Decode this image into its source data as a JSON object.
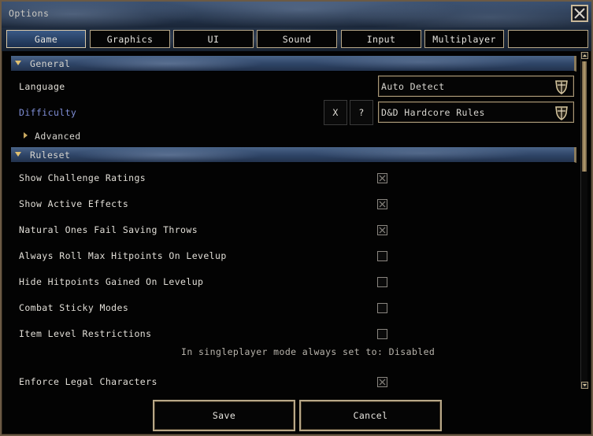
{
  "window": {
    "title": "Options"
  },
  "tabs": [
    {
      "label": "Game",
      "active": true
    },
    {
      "label": "Graphics",
      "active": false
    },
    {
      "label": "UI",
      "active": false
    },
    {
      "label": "Sound",
      "active": false
    },
    {
      "label": "Input",
      "active": false
    },
    {
      "label": "Multiplayer",
      "active": false
    },
    {
      "label": "",
      "active": false
    }
  ],
  "general": {
    "header": "General",
    "language_label": "Language",
    "language_value": "Auto Detect",
    "difficulty_label": "Difficulty",
    "difficulty_value": "D&D Hardcore Rules",
    "reset_button": "X",
    "help_button": "?",
    "advanced_label": "Advanced"
  },
  "ruleset": {
    "header": "Ruleset",
    "options": [
      {
        "label": "Show Challenge Ratings",
        "checked": true
      },
      {
        "label": "Show Active Effects",
        "checked": true
      },
      {
        "label": "Natural Ones Fail Saving Throws",
        "checked": true
      },
      {
        "label": "Always Roll Max Hitpoints On Levelup",
        "checked": false
      },
      {
        "label": "Hide Hitpoints Gained On Levelup",
        "checked": false
      },
      {
        "label": "Combat Sticky Modes",
        "checked": false
      },
      {
        "label": "Item Level Restrictions",
        "checked": false
      },
      {
        "label": "Enforce Legal Characters",
        "checked": true
      }
    ],
    "item_level_note": "In singleplayer mode always set to: Disabled"
  },
  "footer": {
    "save_label": "Save",
    "cancel_label": "Cancel"
  },
  "colors": {
    "accent_blue": "#2a4468",
    "border_gold": "#b8a888",
    "link": "#7f8ed6"
  }
}
